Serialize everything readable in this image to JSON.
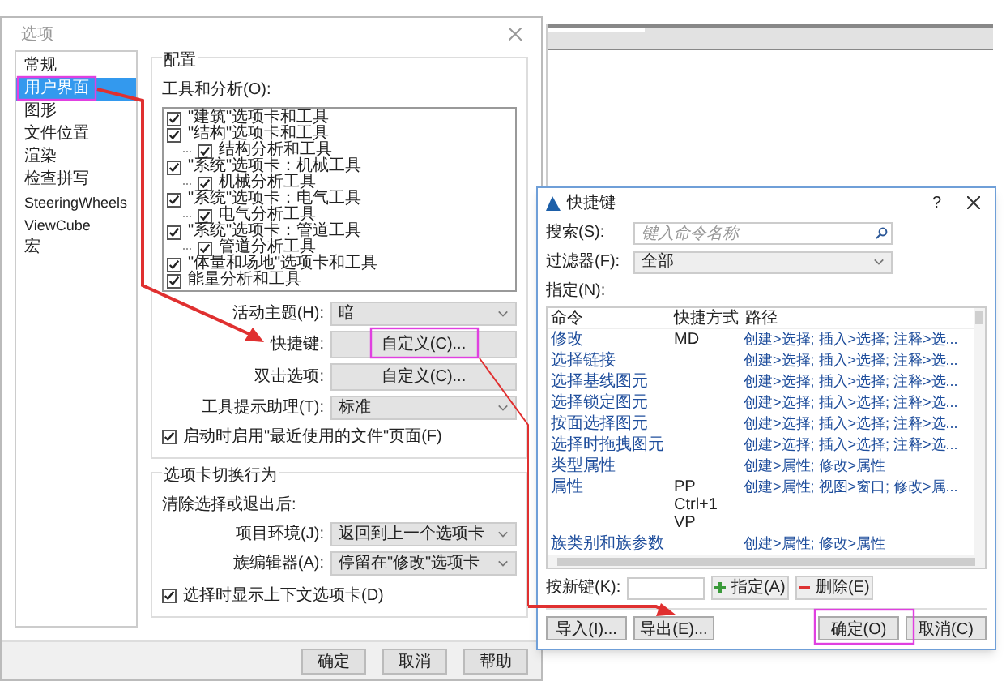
{
  "options_dialog": {
    "title": "选项",
    "sidebar": {
      "items": [
        {
          "label": "常规",
          "selected": false
        },
        {
          "label": "用户界面",
          "selected": true
        },
        {
          "label": "图形",
          "selected": false
        },
        {
          "label": "文件位置",
          "selected": false
        },
        {
          "label": "渲染",
          "selected": false
        },
        {
          "label": "检查拼写",
          "selected": false
        },
        {
          "label": "SteeringWheels",
          "selected": false
        },
        {
          "label": "ViewCube",
          "selected": false
        },
        {
          "label": "宏",
          "selected": false
        }
      ]
    },
    "config": {
      "title": "配置",
      "tools_label": "工具和分析(O):",
      "tree": [
        {
          "label": "\"建筑\"选项卡和工具",
          "checked": true
        },
        {
          "label": "\"结构\"选项卡和工具",
          "checked": true,
          "children": [
            {
              "label": "结构分析和工具",
              "checked": true
            }
          ]
        },
        {
          "label": "\"系统\"选项卡：机械工具",
          "checked": true,
          "children": [
            {
              "label": "机械分析工具",
              "checked": true
            }
          ]
        },
        {
          "label": "\"系统\"选项卡：电气工具",
          "checked": true,
          "children": [
            {
              "label": "电气分析工具",
              "checked": true
            }
          ]
        },
        {
          "label": "\"系统\"选项卡：管道工具",
          "checked": true,
          "children": [
            {
              "label": "管道分析工具",
              "checked": true
            }
          ]
        },
        {
          "label": "\"体量和场地\"选项卡和工具",
          "checked": true
        },
        {
          "label": "能量分析和工具",
          "checked": true
        }
      ],
      "fields": [
        {
          "kind": "dropdown",
          "label": "活动主题(H):",
          "value": "暗"
        },
        {
          "kind": "button",
          "label": "快捷键:",
          "value": "自定义(C)..."
        },
        {
          "kind": "button",
          "label": "双击选项:",
          "value": "自定义(C)..."
        },
        {
          "kind": "dropdown",
          "label": "工具提示助理(T):",
          "value": "标准"
        }
      ],
      "recent_files": {
        "label": "启动时启用\"最近使用的文件\"页面(F)",
        "checked": true
      }
    },
    "tab_switching": {
      "title": "选项卡切换行为",
      "subtitle": "清除选择或退出后:",
      "fields": [
        {
          "label": "项目环境(J):",
          "value": "返回到上一个选项卡"
        },
        {
          "label": "族编辑器(A):",
          "value": "停留在\"修改\"选项卡"
        }
      ],
      "context_tabs": {
        "label": "选择时显示上下文选项卡(D)",
        "checked": true
      }
    },
    "buttons": [
      "确定",
      "取消",
      "帮助"
    ]
  },
  "shortcuts_dialog": {
    "title": "快捷键",
    "help": "?",
    "search": {
      "label": "搜索(S):",
      "placeholder": "键入命令名称"
    },
    "filter": {
      "label": "过滤器(F):",
      "value": "全部"
    },
    "assign_label": "指定(N):",
    "table": {
      "columns": [
        "命令",
        "快捷方式",
        "路径"
      ],
      "rows": [
        {
          "command": "修改",
          "shortcuts": [
            "MD"
          ],
          "path": "创建>选择; 插入>选择; 注释>选..."
        },
        {
          "command": "选择链接",
          "shortcuts": [],
          "path": "创建>选择; 插入>选择; 注释>选..."
        },
        {
          "command": "选择基线图元",
          "shortcuts": [],
          "path": "创建>选择; 插入>选择; 注释>选..."
        },
        {
          "command": "选择锁定图元",
          "shortcuts": [],
          "path": "创建>选择; 插入>选择; 注释>选..."
        },
        {
          "command": "按面选择图元",
          "shortcuts": [],
          "path": "创建>选择; 插入>选择; 注释>选..."
        },
        {
          "command": "选择时拖拽图元",
          "shortcuts": [],
          "path": "创建>选择; 插入>选择; 注释>选..."
        },
        {
          "command": "类型属性",
          "shortcuts": [],
          "path": "创建>属性; 修改>属性"
        },
        {
          "command": "属性",
          "shortcuts": [
            "PP",
            "Ctrl+1",
            "VP"
          ],
          "path": "创建>属性; 视图>窗口; 修改>属..."
        },
        {
          "command": "族类别和族参数",
          "shortcuts": [],
          "path": "创建>属性; 修改>属性"
        }
      ]
    },
    "new_key_label": "按新键(K):",
    "assign_button": "指定(A)",
    "remove_button": "删除(E)",
    "buttons": [
      "导入(I)...",
      "导出(E)...",
      "确定(O)",
      "取消(C)"
    ]
  }
}
